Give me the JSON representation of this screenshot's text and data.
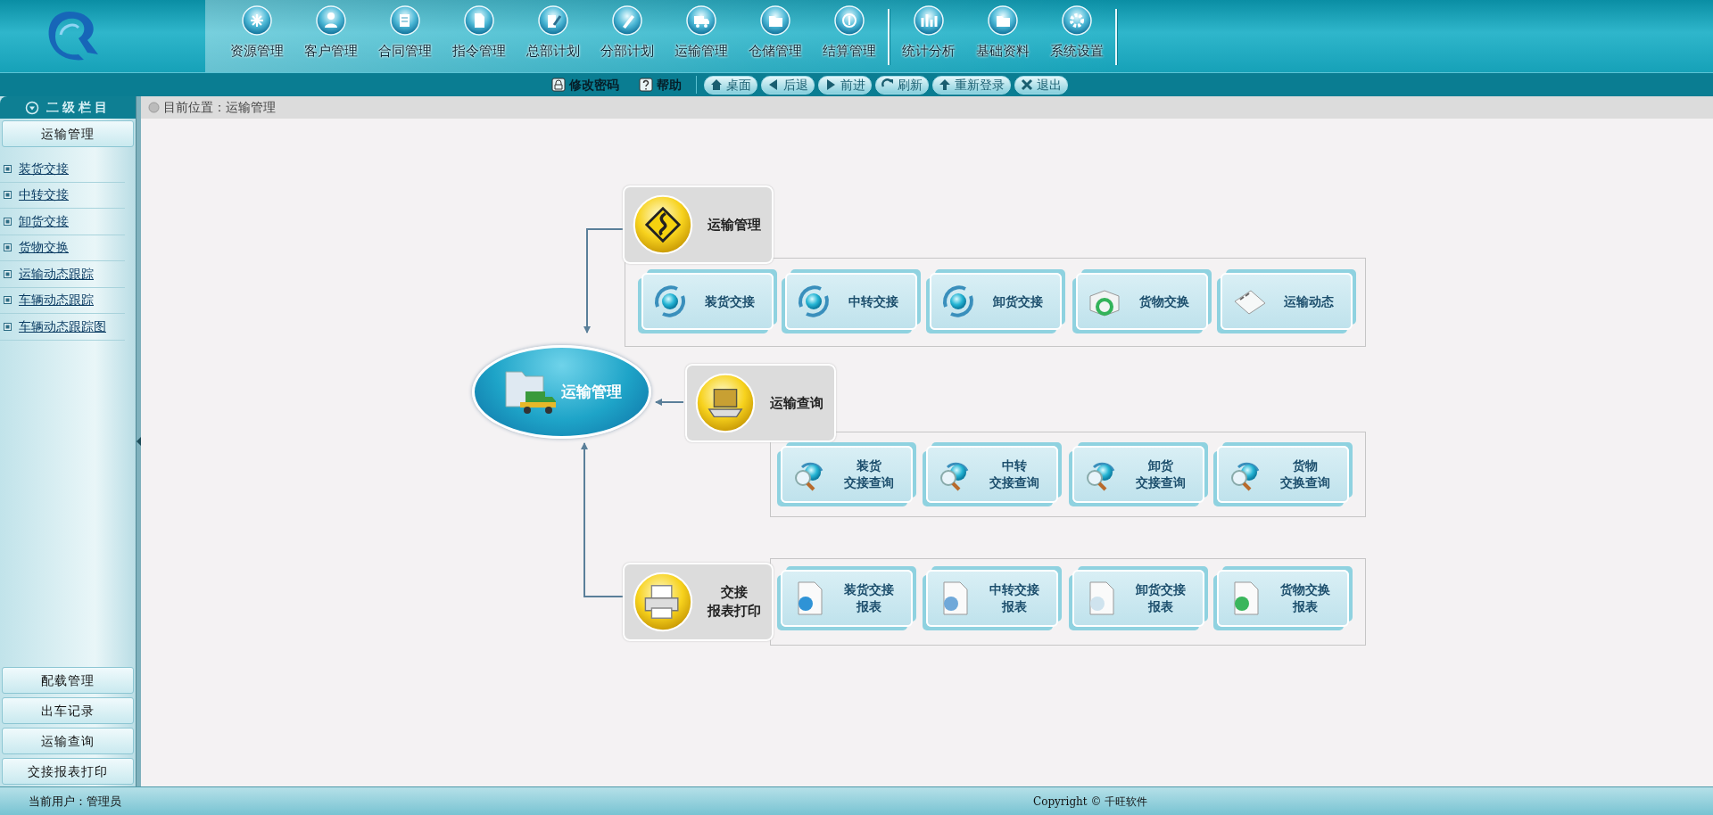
{
  "header": {
    "nav_groups": [
      [
        "资源管理",
        "客户管理",
        "合同管理",
        "指令管理",
        "总部计划",
        "分部计划",
        "运输管理",
        "仓储管理",
        "结算管理"
      ],
      [
        "统计分析",
        "基础资料",
        "系统设置"
      ]
    ]
  },
  "toolbar": {
    "links": [
      "修改密码",
      "帮助"
    ],
    "buttons": [
      "桌面",
      "后退",
      "前进",
      "刷新",
      "重新登录",
      "退出"
    ]
  },
  "sidebar": {
    "title": "二级栏目",
    "sections": [
      {
        "label": "运输管理",
        "expanded": true,
        "items": [
          "装货交接",
          "中转交接",
          "卸货交接",
          "货物交换",
          "运输动态跟踪",
          "车辆动态跟踪",
          "车辆动态跟踪图"
        ]
      },
      {
        "label": "配载管理",
        "expanded": false
      },
      {
        "label": "出车记录",
        "expanded": false
      },
      {
        "label": "运输查询",
        "expanded": false
      },
      {
        "label": "交接报表打印",
        "expanded": false
      }
    ]
  },
  "breadcrumb": "目前位置：运输管理",
  "diagram": {
    "center": "运输管理",
    "groups": [
      {
        "title": [
          "运输管理"
        ],
        "tiles": [
          [
            "装货交接"
          ],
          [
            "中转交接"
          ],
          [
            "卸货交接"
          ],
          [
            "货物交换"
          ],
          [
            "运输动态"
          ]
        ]
      },
      {
        "title": [
          "运输查询"
        ],
        "tiles": [
          [
            "装货",
            "交接查询"
          ],
          [
            "中转",
            "交接查询"
          ],
          [
            "卸货",
            "交接查询"
          ],
          [
            "货物",
            "交换查询"
          ]
        ]
      },
      {
        "title": [
          "交接",
          "报表打印"
        ],
        "tiles": [
          [
            "装货交接",
            "报表"
          ],
          [
            "中转交接",
            "报表"
          ],
          [
            "卸货交接",
            "报表"
          ],
          [
            "货物交换",
            "报表"
          ]
        ]
      }
    ]
  },
  "status_bar": {
    "user": "当前用户：管理员",
    "copyright": "Copyright ©  千旺软件"
  }
}
